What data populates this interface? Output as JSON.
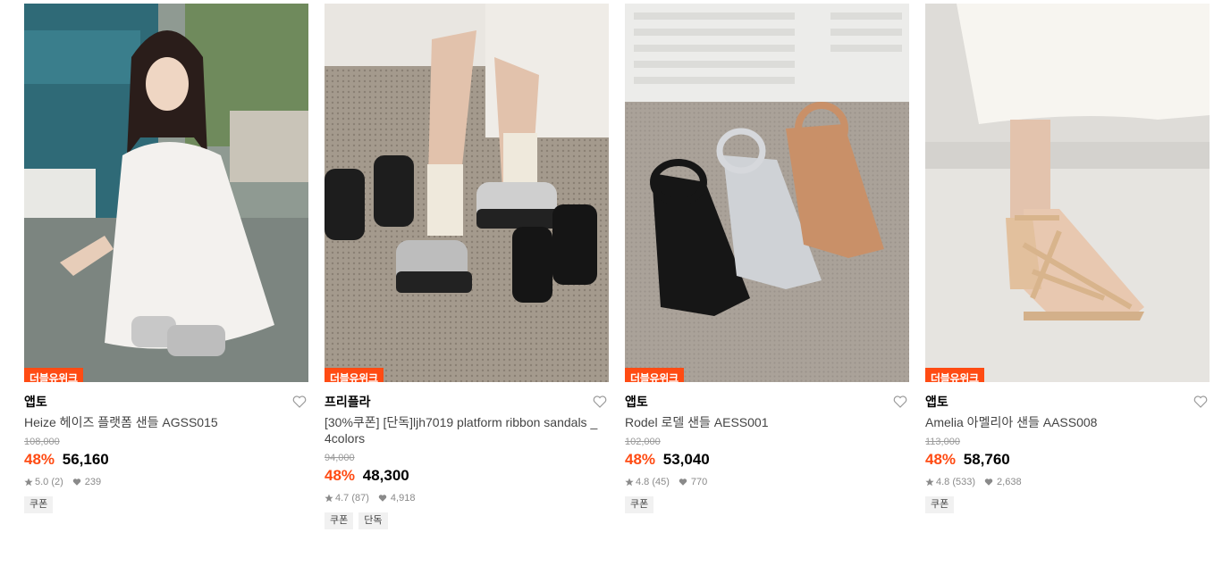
{
  "products": [
    {
      "badge": "더블유위크",
      "brand": "앱토",
      "name": "Heize 헤이즈 플랫폼 샌들 AGSS015",
      "original_price": "108,000",
      "discount": "48%",
      "price": "56,160",
      "rating": "5.0 (2)",
      "likes": "239",
      "tags": [
        "쿠폰"
      ],
      "image": "woman-white-dress-crouching",
      "favorite_icon": "heart-outline-icon"
    },
    {
      "badge": "더블유위크",
      "brand": "프리플라",
      "name": "[30%쿠폰] [단독]ljh7019 platform ribbon sandals _ 4colors",
      "original_price": "94,000",
      "discount": "48%",
      "price": "48,300",
      "rating": "4.7 (87)",
      "likes": "4,918",
      "tags": [
        "쿠폰",
        "단독"
      ],
      "image": "platform-sandals-on-carpet",
      "favorite_icon": "heart-outline-icon"
    },
    {
      "badge": "더블유위크",
      "brand": "앱토",
      "name": "Rodel 로델 샌들 AESS001",
      "original_price": "102,000",
      "discount": "48%",
      "price": "53,040",
      "rating": "4.8 (45)",
      "likes": "770",
      "tags": [
        "쿠폰"
      ],
      "image": "fisherman-sandals-three-colors",
      "favorite_icon": "heart-outline-icon"
    },
    {
      "badge": "더블유위크",
      "brand": "앱토",
      "name": "Amelia 아멜리아 샌들 AASS008",
      "original_price": "113,000",
      "discount": "48%",
      "price": "58,760",
      "rating": "4.8 (533)",
      "likes": "2,638",
      "tags": [
        "쿠폰"
      ],
      "image": "beige-strappy-heel-sandal",
      "favorite_icon": "heart-outline-icon"
    }
  ],
  "colors": {
    "accent": "#ff4b13",
    "tag_bg": "#f1f1f1",
    "muted": "#8a8a8a"
  }
}
